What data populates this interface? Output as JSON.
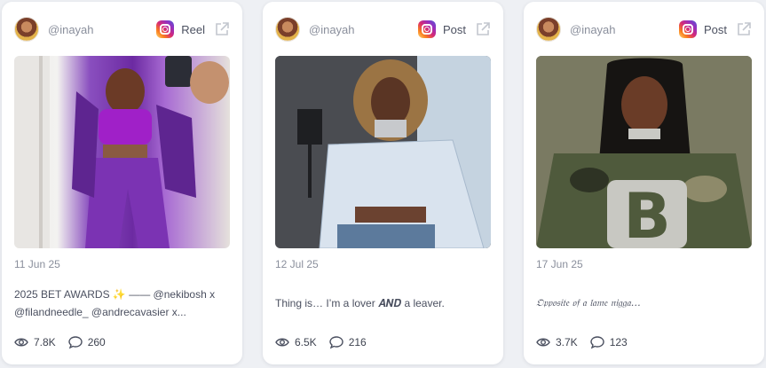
{
  "cards": [
    {
      "handle": "@inayah",
      "type": "Reel",
      "date": "11 Jun 25",
      "caption": "2025 BET AWARDS ✨ —— @nekibosh x @filandneedle_ @andrecavasier x...",
      "views": "7.8K",
      "comments": "260",
      "icons": {
        "platform": "instagram-icon",
        "open": "external-link-icon",
        "views": "eye-icon",
        "comments": "comment-icon"
      }
    },
    {
      "handle": "@inayah",
      "type": "Post",
      "date": "12 Jul 25",
      "caption": "Thing is… I’m a lover 𝑨𝑵𝑫 a leaver.",
      "views": "6.5K",
      "comments": "216",
      "icons": {
        "platform": "instagram-icon",
        "open": "external-link-icon",
        "views": "eye-icon",
        "comments": "comment-icon"
      }
    },
    {
      "handle": "@inayah",
      "type": "Post",
      "date": "17 Jun 25",
      "caption": "𝔒𝔭𝔭𝔬𝔰𝔦𝔱𝔢 𝔬𝔣 𝔞 𝔩𝔞𝔪𝔢 𝔫𝔦𝔤𝔤𝔞…",
      "views": "3.7K",
      "comments": "123",
      "icons": {
        "platform": "instagram-icon",
        "open": "external-link-icon",
        "views": "eye-icon",
        "comments": "comment-icon"
      }
    }
  ],
  "colors": {
    "background": "#eef0f4",
    "card": "#ffffff",
    "muted_text": "#8a8f9c",
    "body_text": "#4b5060"
  }
}
